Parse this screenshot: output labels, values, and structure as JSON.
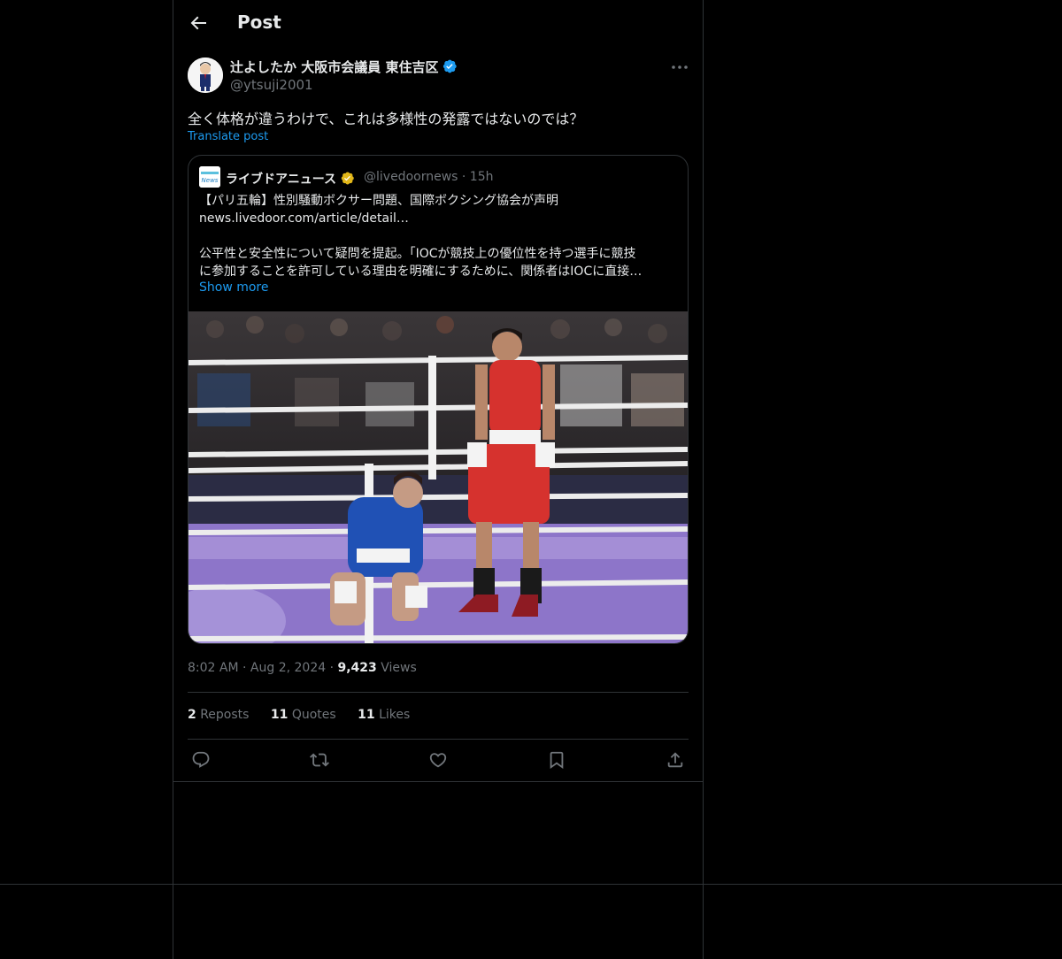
{
  "header": {
    "title": "Post"
  },
  "post": {
    "author_name": "辻よしたか 大阪市会議員 東住吉区",
    "author_handle": "@ytsuji2001",
    "text": "全く体格が違うわけで、これは多様性の発露ではないのでは？",
    "translate_label": "Translate post",
    "time": "8:02 AM",
    "date": "Aug 2, 2024",
    "views_count": "9,423",
    "views_label": "Views",
    "separator": "·"
  },
  "quote": {
    "author_name": "ライブドアニュース",
    "author_handle": "@livedoornews",
    "time": "15h",
    "line1": "【パリ五輪】性別騒動ボクサー問題、国際ボクシング協会が声明",
    "line2": "news.livedoor.com/article/detail…",
    "line3": "公平性と安全性について疑問を提起。「IOCが競技上の優位性を持つ選手に競技",
    "line4": "に参加することを許可している理由を明確にするために、関係者はIOCに直接…",
    "show_more": "Show more",
    "avatar_label": "News"
  },
  "stats": {
    "reposts_count": "2",
    "reposts_label": "Reposts",
    "quotes_count": "11",
    "quotes_label": "Quotes",
    "likes_count": "11",
    "likes_label": "Likes"
  },
  "icons": [
    "back-arrow-icon",
    "verified-badge-icon",
    "more-icon",
    "reply-icon",
    "retweet-icon",
    "like-icon",
    "bookmark-icon",
    "share-icon"
  ],
  "colors": {
    "accent": "#1d9bf0",
    "verified_blue": "#1d9bf0",
    "verified_gold": "#e2b719",
    "border": "#2f3336",
    "muted": "#71767b"
  }
}
